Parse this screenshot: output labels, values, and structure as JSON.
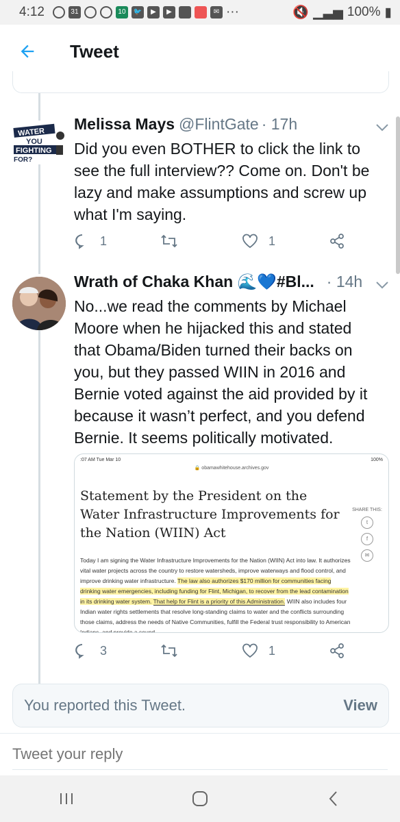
{
  "status_bar": {
    "time": "4:12",
    "battery": "100%",
    "calendar_day": "31",
    "badge_num": "10"
  },
  "header": {
    "title": "Tweet"
  },
  "tweets": [
    {
      "name": "Melissa Mays",
      "handle": "@FlintGate",
      "time": "· 17h",
      "text": "Did you even BOTHER to click the link to see the full interview?? Come on. Don't be lazy and make assumptions and screw up what I'm saying.",
      "avatar_text": [
        "WATER",
        "YOU",
        "FIGHTING",
        "FOR?"
      ],
      "replies": "1",
      "retweets": "",
      "likes": "1"
    },
    {
      "name": "Wrath of Chaka Khan 🌊💙#Bl...",
      "handle": "",
      "time": "· 14h",
      "text": "No...we read the comments by Michael Moore when he hijacked this and stated that Obama/Biden turned their backs on you, but they passed WIIN in 2016 and Bernie voted against the aid provided by it because it wasn’t perfect, and you defend Bernie. It seems politically motivated.",
      "replies": "3",
      "retweets": "",
      "likes": "1"
    }
  ],
  "embed": {
    "status_time": ":07 AM   Tue Mar 10",
    "status_battery": "100%",
    "url": "obamawhitehouse.archives.gov",
    "title": "Statement by the President on the Water Infrastructure Improvements for the Nation (WIIN) Act",
    "share_label": "SHARE THIS:",
    "para_1": "Today I am signing the Water Infrastructure Improvements for the Nation (WIIN) Act into law. It authorizes vital water projects across the country to restore watersheds, improve waterways and flood control, and improve drinking water infrastructure. ",
    "para_hl": "The law also authorizes $170 million for communities facing drinking water emergencies, including funding for Flint, Michigan, to recover from the lead contamination in its drinking water system. ",
    "para_ul": "That help for Flint is a priority of this Administration.",
    "para_2": " WIIN also includes four Indian water rights settlements that resolve long-standing claims to water and the conflicts surrounding those claims, address the needs of Native Communities, fulfill the Federal trust responsibility to American Indians, and provide a sound"
  },
  "reported": {
    "text": "You reported this Tweet.",
    "view": "View"
  },
  "reply": {
    "placeholder": "Tweet your reply"
  },
  "colors": {
    "accent": "#1da1f2",
    "muted": "#657786",
    "highlight": "#fff3a3"
  }
}
